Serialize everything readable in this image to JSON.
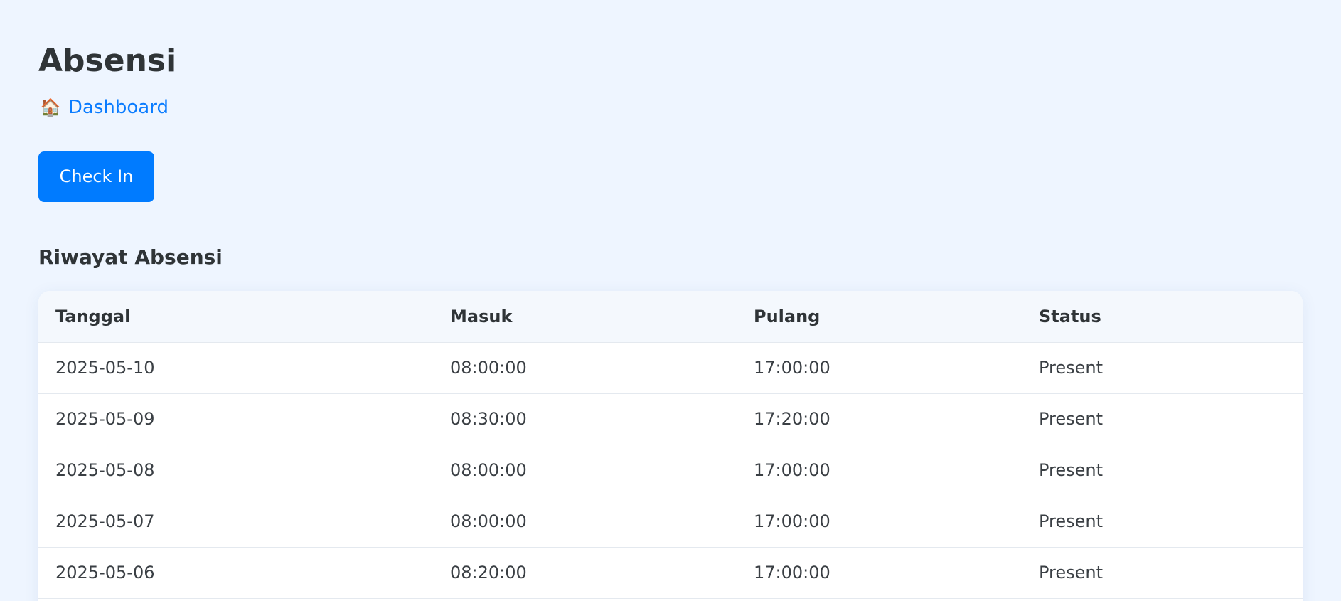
{
  "page": {
    "title": "Absensi",
    "breadcrumb": {
      "icon": "house-emoji",
      "icon_glyph": "🏠",
      "label": "Dashboard"
    },
    "checkin_button": "Check In",
    "section_title": "Riwayat Absensi"
  },
  "table": {
    "headers": [
      "Tanggal",
      "Masuk",
      "Pulang",
      "Status"
    ],
    "rows": [
      [
        "2025-05-10",
        "08:00:00",
        "17:00:00",
        "Present"
      ],
      [
        "2025-05-09",
        "08:30:00",
        "17:20:00",
        "Present"
      ],
      [
        "2025-05-08",
        "08:00:00",
        "17:00:00",
        "Present"
      ],
      [
        "2025-05-07",
        "08:00:00",
        "17:00:00",
        "Present"
      ],
      [
        "2025-05-06",
        "08:20:00",
        "17:00:00",
        "Present"
      ]
    ]
  },
  "colors": {
    "background": "#eef5ff",
    "accent": "#007bff",
    "link": "#0a7cff",
    "text": "#2f3437"
  }
}
